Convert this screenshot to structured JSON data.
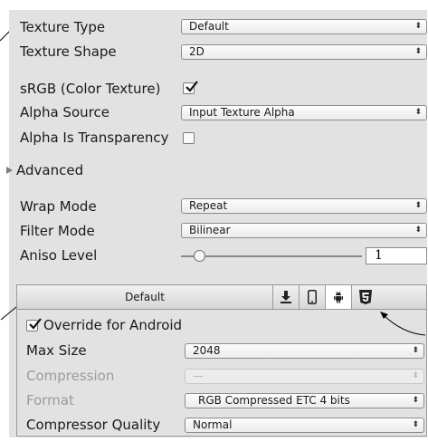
{
  "fields": {
    "texture_type": {
      "label": "Texture Type",
      "value": "Default"
    },
    "texture_shape": {
      "label": "Texture Shape",
      "value": "2D"
    },
    "srgb": {
      "label": "sRGB (Color Texture)",
      "checked": true
    },
    "alpha_source": {
      "label": "Alpha Source",
      "value": "Input Texture Alpha"
    },
    "alpha_is_transparency": {
      "label": "Alpha Is Transparency",
      "checked": false
    },
    "advanced": {
      "label": "Advanced"
    },
    "wrap_mode": {
      "label": "Wrap Mode",
      "value": "Repeat"
    },
    "filter_mode": {
      "label": "Filter Mode",
      "value": "Bilinear"
    },
    "aniso_level": {
      "label": "Aniso Level",
      "value": "1",
      "slider_fraction": 0.1
    }
  },
  "platform_tabs": {
    "default_label": "Default",
    "items": [
      "download-icon",
      "phone-icon",
      "android-icon",
      "html5-icon"
    ],
    "active": "android-icon"
  },
  "android": {
    "override_label": "Override for Android",
    "override_checked": true,
    "max_size": {
      "label": "Max Size",
      "value": "2048"
    },
    "compression": {
      "label": "Compression",
      "value": "—",
      "disabled": true
    },
    "format": {
      "label": "Format",
      "value": "RGB Compressed ETC 4 bits"
    },
    "compressor_quality": {
      "label": "Compressor Quality",
      "value": "Normal"
    }
  },
  "dropdown_arrow": "⬍",
  "colors": {
    "panel": "#e2e2e2",
    "dim_text": "#9b9b9b"
  }
}
